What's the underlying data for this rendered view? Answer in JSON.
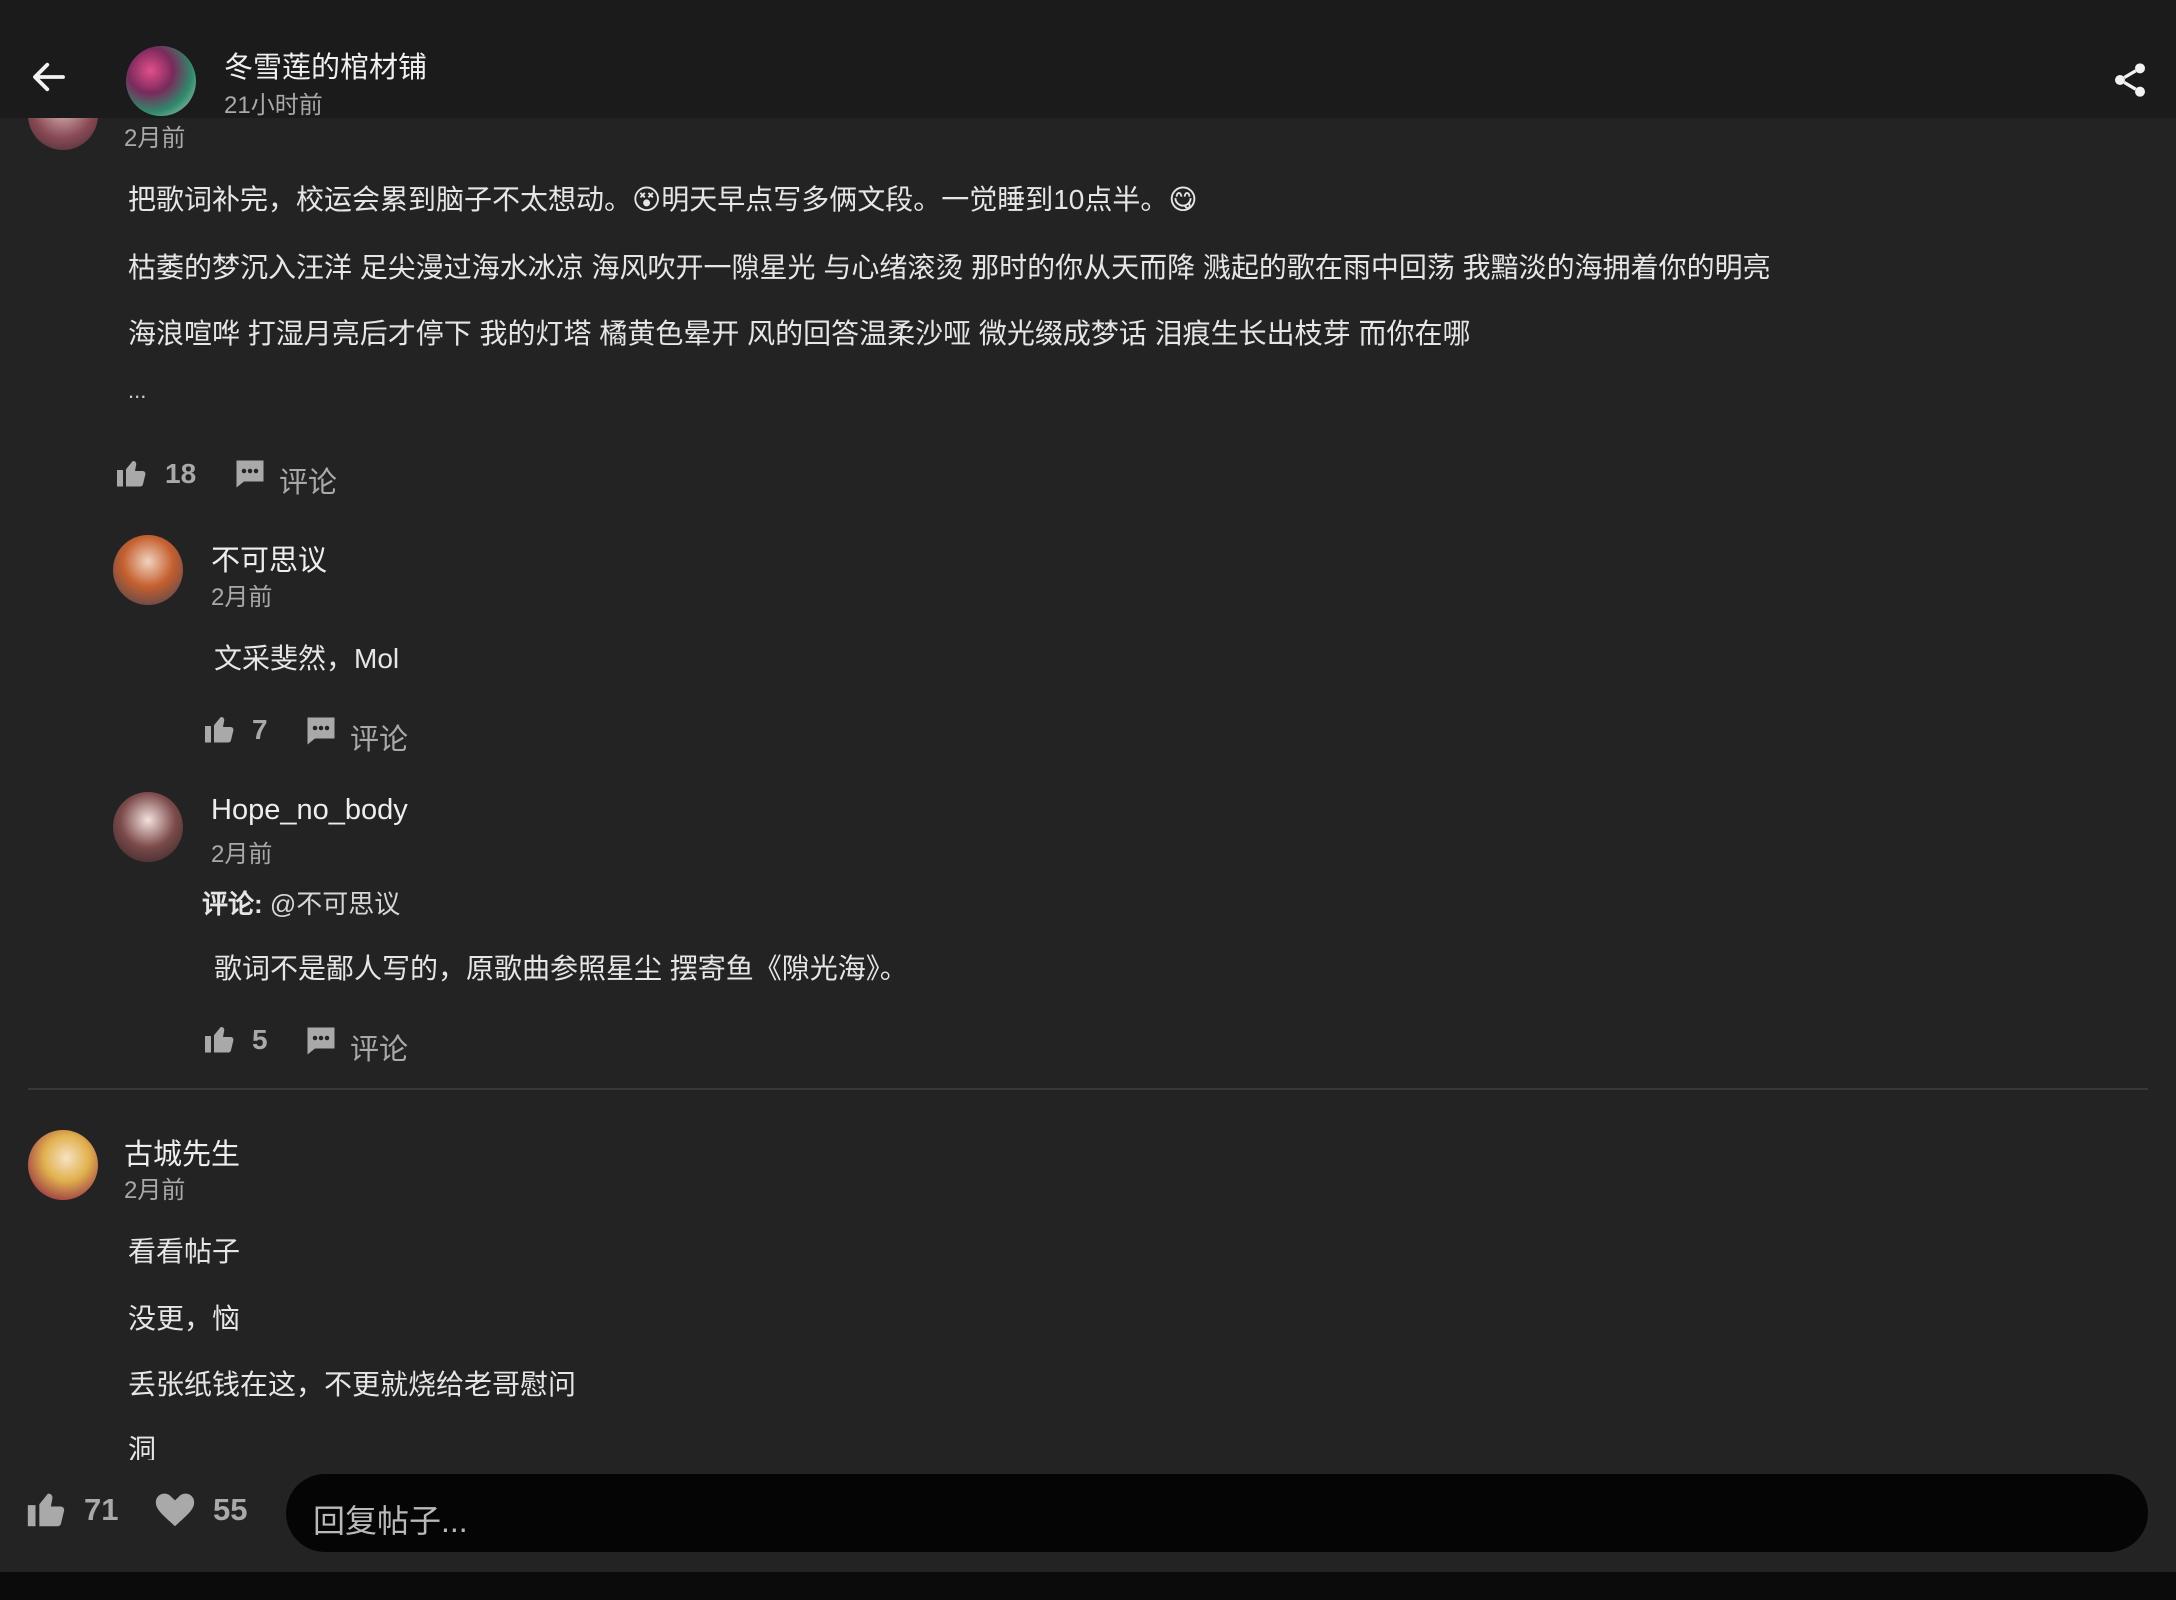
{
  "header": {
    "title": "冬雪莲的棺材铺",
    "time": "21小时前",
    "back_icon": "arrow-left-icon",
    "share_icon": "share-icon"
  },
  "comments": [
    {
      "time": "2月前",
      "lines": [
        "把歌词补完，校运会累到脑子不太想动。😵明天早点写多俩文段。一觉睡到10点半。😋",
        "枯萎的梦沉入汪洋 足尖漫过海水冰凉 海风吹开一隙星光 与心绪滚烫 那时的你从天而降 溅起的歌在雨中回荡 我黯淡的海拥着你的明亮",
        "海浪喧哗 打湿月亮后才停下 我的灯塔 橘黄色晕开 风的回答温柔沙哑 微光缀成梦话 泪痕生长出枝芽 而你在哪",
        "..."
      ],
      "likes": "18",
      "comment_label": "评论"
    },
    {
      "name": "古城先生",
      "time": "2月前",
      "lines": [
        "看看帖子",
        "没更，恼",
        "丢张纸钱在这，不更就烧给老哥慰问",
        "洞"
      ]
    }
  ],
  "replies": [
    {
      "name": "不可思议",
      "time": "2月前",
      "text": "文采斐然，Mol",
      "likes": "7",
      "comment_label": "评论"
    },
    {
      "name": "Hope_no_body",
      "time": "2月前",
      "reply_prefix": "评论:",
      "reply_to": "@不可思议",
      "text": "歌词不是鄙人写的，原歌曲参照星尘 摆寄鱼《隙光海》。",
      "likes": "5",
      "comment_label": "评论"
    }
  ],
  "footer": {
    "likes": "71",
    "favorites": "55",
    "reply_placeholder": "回复帖子..."
  },
  "colors": {
    "background": "#232323",
    "topbar": "#1b1b1b",
    "muted": "#a9a9a9",
    "reply_box": "#050505"
  }
}
